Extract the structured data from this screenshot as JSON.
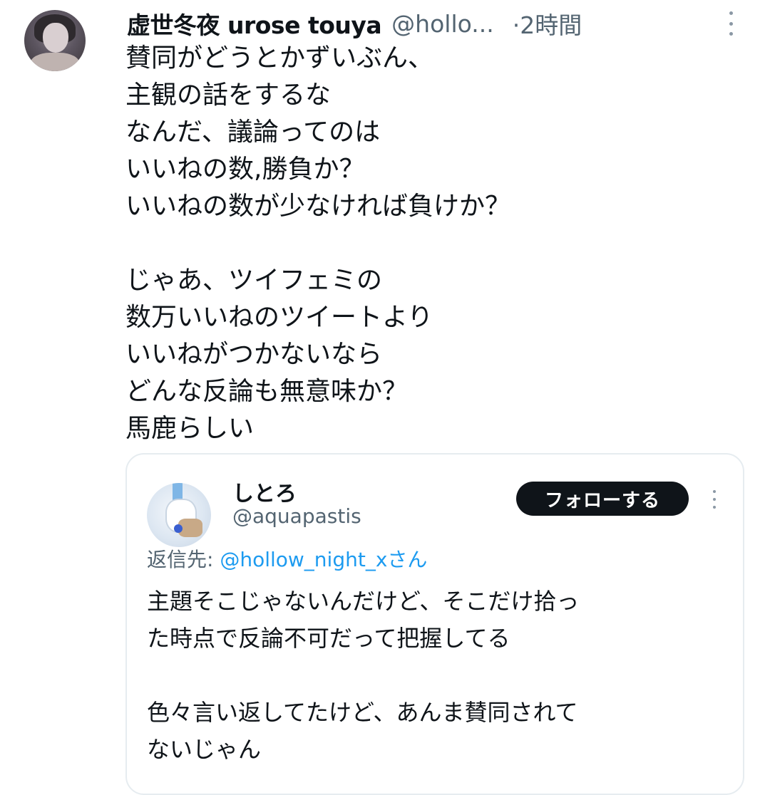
{
  "tweet": {
    "display_name": "虚世冬夜 urose touya",
    "handle": "@hollo...",
    "time": "·2時間",
    "lines": [
      "賛同がどうとかずいぶん、",
      "主観の話をするな",
      "なんだ、議論ってのは",
      "いいねの数,勝負か？",
      "いいねの数が少なければ負けか？",
      "",
      "じゃあ、ツイフェミの",
      "数万いいねのツイートより",
      "いいねがつかないなら",
      "どんな反論も無意味か？",
      "馬鹿らしい"
    ]
  },
  "quote": {
    "display_name": "しとろ",
    "handle": "@aquapastis",
    "follow_label": "フォローする",
    "reply_prefix": "返信先: ",
    "reply_mention": "@hollow_night_xさん",
    "lines": [
      "主題そこじゃないんだけど、そこだけ拾っ",
      "た時点で反論不可だって把握してる",
      "",
      "色々言い返してたけど、あんま賛同されて",
      "ないじゃん"
    ]
  },
  "icons": {
    "avatar": "user-avatar",
    "more": "more-vertical-icon",
    "quote_avatar": "quoted-user-avatar"
  },
  "colors": {
    "text": "#0f1419",
    "secondary": "#536471",
    "mention": "#1d9bf0",
    "follow_bg": "#0f1419"
  }
}
